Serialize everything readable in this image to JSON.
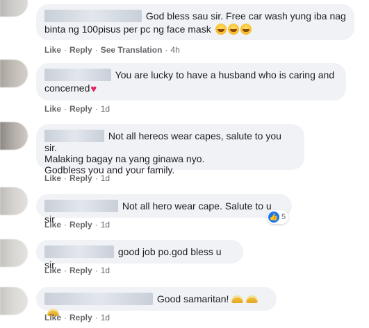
{
  "actions": {
    "like": "Like",
    "reply": "Reply",
    "see_translation": "See Translation",
    "separator": "·"
  },
  "comments": [
    {
      "text_line1": "God bless sau sir. Free car wash yung iba nag",
      "text_line2": "binta ng 100pisus per pc ng face mask",
      "emojis": [
        "grinning-squinting-face-emoji",
        "grinning-squinting-face-emoji",
        "grinning-squinting-face-emoji"
      ],
      "time": "4h"
    },
    {
      "text_line1": "You are lucky to have a husband who is caring and",
      "text_line2": "concerned",
      "emojis": [
        "red-heart-emoji"
      ],
      "time": "1d"
    },
    {
      "text_line1": "Not all hereos wear capes, salute to you sir.",
      "text_line2": "Malaking bagay na yang ginawa nyo.",
      "text_line3": "Godbless you and your family.",
      "time": "1d"
    },
    {
      "text_line1": "Not all hero wear cape. Salute to u sir",
      "reaction_count": "5",
      "time": "1d"
    },
    {
      "text_line1": "good job po.god bless u sir.",
      "time": "1d"
    },
    {
      "text_line1": "Good samaritan!",
      "emojis": [
        "taco-emoji",
        "taco-emoji",
        "taco-emoji"
      ],
      "time": "1d"
    }
  ]
}
